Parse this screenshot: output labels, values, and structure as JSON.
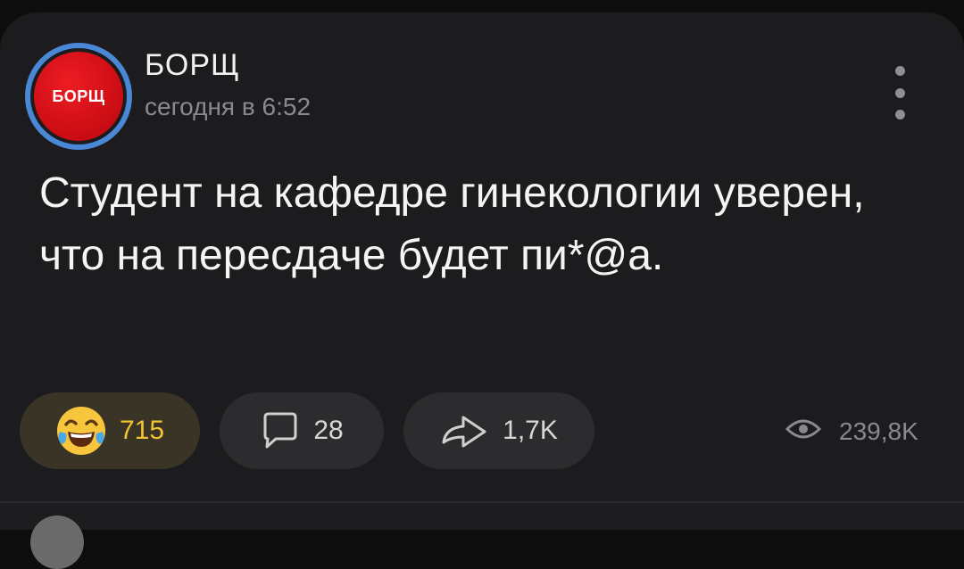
{
  "post": {
    "channel_name": "БОРЩ",
    "avatar_text": "БОРЩ",
    "time": "сегодня в 6:52",
    "text": "Студент на кафедре гинекологии уверен, что на пересдаче будет пи*@а."
  },
  "actions": {
    "reactions": {
      "icon": "laughing-tears-emoji-icon",
      "count": "715"
    },
    "comments": {
      "icon": "speech-bubble-icon",
      "count": "28"
    },
    "shares": {
      "icon": "share-arrow-icon",
      "count": "1,7K"
    },
    "views": {
      "icon": "eye-icon",
      "count": "239,8K"
    }
  },
  "colors": {
    "background": "#0d0d0d",
    "card": "#1c1c1e",
    "pill": "#2c2c2e",
    "reaction_pill": "#3a3426",
    "reaction_count": "#f2c431",
    "avatar_red": "#d20f16",
    "avatar_ring": "#4a87d6"
  }
}
